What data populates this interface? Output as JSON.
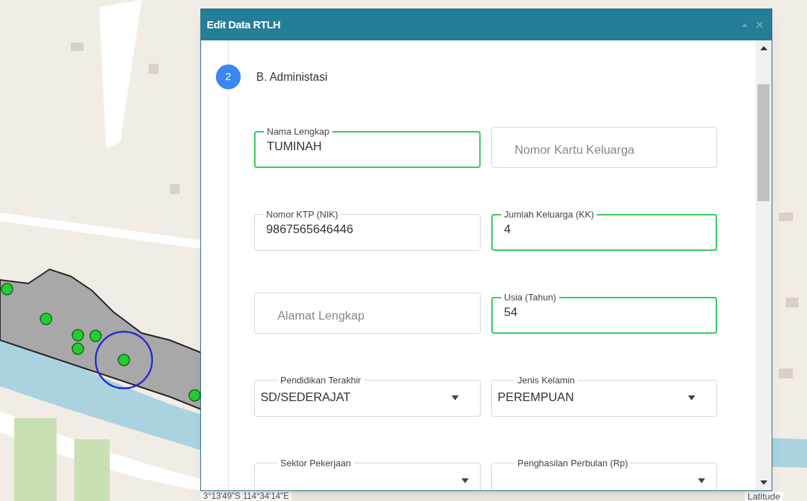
{
  "map": {
    "coordinates": "3°13'49\"S 114°34'14\"E",
    "latitude_label": "Latitude"
  },
  "dialog": {
    "title": "Edit Data RTLH",
    "step": {
      "number": "2",
      "title": "B. Administasi"
    },
    "fields": [
      {
        "kind": "text",
        "label": "Nama Lengkap",
        "value": "TUMINAH",
        "valid": true
      },
      {
        "kind": "text",
        "placeholder": "Nomor Kartu Keluarga",
        "valid": false
      },
      {
        "kind": "text",
        "label": "Nomor KTP (NIK)",
        "value": "9867565646446",
        "valid": false
      },
      {
        "kind": "text",
        "label": "Jumlah Keluarga (KK)",
        "value": "4",
        "valid": true
      },
      {
        "kind": "text",
        "placeholder": "Alamat Lengkap",
        "valid": false
      },
      {
        "kind": "text",
        "label": "Usia (Tahun)",
        "value": "54",
        "valid": true
      },
      {
        "kind": "select",
        "label": "Pendidikan Terakhir",
        "value": "SD/SEDERAJAT",
        "valid": false
      },
      {
        "kind": "select",
        "label": "Jenis Kelamin",
        "value": "PEREMPUAN",
        "valid": false
      },
      {
        "kind": "select",
        "label": "Sektor Pekerjaan",
        "valid": false
      },
      {
        "kind": "select",
        "label": "Penghasilan Perbulan (Rp)",
        "valid": false
      }
    ]
  }
}
